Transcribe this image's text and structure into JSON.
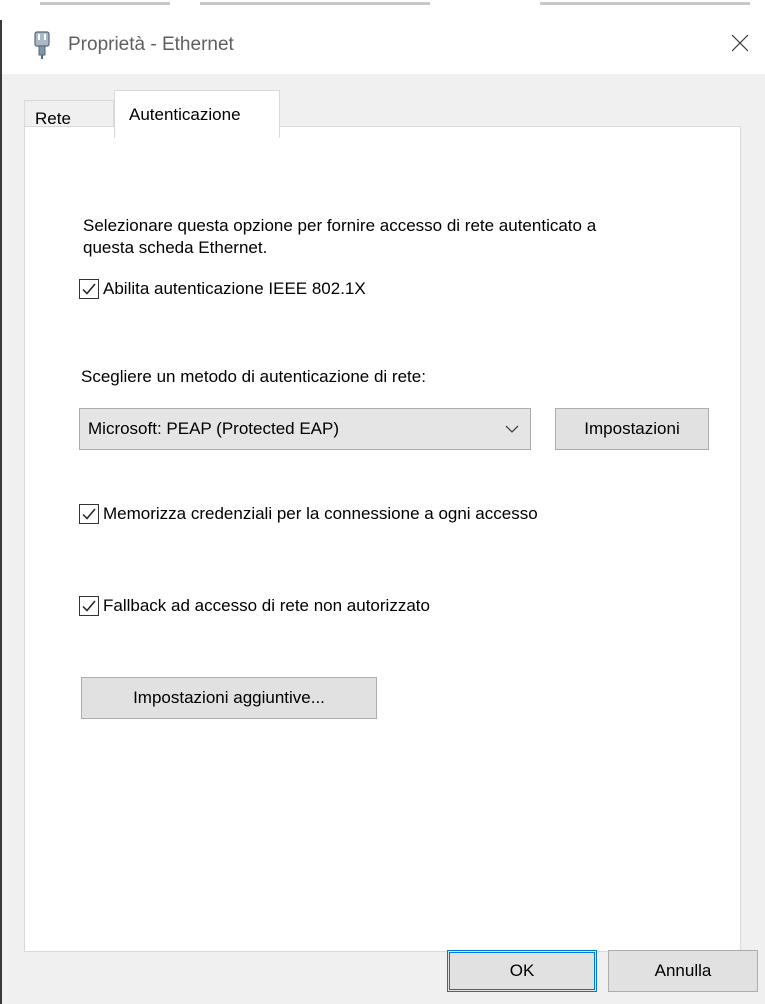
{
  "window": {
    "title": "Proprietà - Ethernet"
  },
  "tabs": [
    {
      "label": "Rete",
      "active": false
    },
    {
      "label": "Autenticazione",
      "active": true
    }
  ],
  "auth": {
    "description": "Selezionare questa opzione per fornire accesso di rete autenticato a questa scheda Ethernet.",
    "enable_8021x": {
      "label": "Abilita autenticazione IEEE 802.1X",
      "checked": true
    },
    "method_label": "Scegliere un metodo di autenticazione di rete:",
    "method_select": {
      "selected": "Microsoft: PEAP (Protected EAP)"
    },
    "settings_button": "Impostazioni",
    "remember_credentials": {
      "label": "Memorizza credenziali per la connessione a ogni accesso",
      "checked": true
    },
    "fallback": {
      "label": "Fallback ad accesso di rete non autorizzato",
      "checked": true
    },
    "additional_settings_button": "Impostazioni aggiuntive..."
  },
  "footer": {
    "ok_label": "OK",
    "cancel_label": "Annulla"
  },
  "icons": {
    "app": "ethernet-plug-icon",
    "close": "close-icon",
    "dropdown": "chevron-down-icon",
    "check": "checkmark-icon"
  },
  "colors": {
    "accent": "#0078d7",
    "window_bg": "#f0f0f0",
    "panel_bg": "#ffffff"
  }
}
